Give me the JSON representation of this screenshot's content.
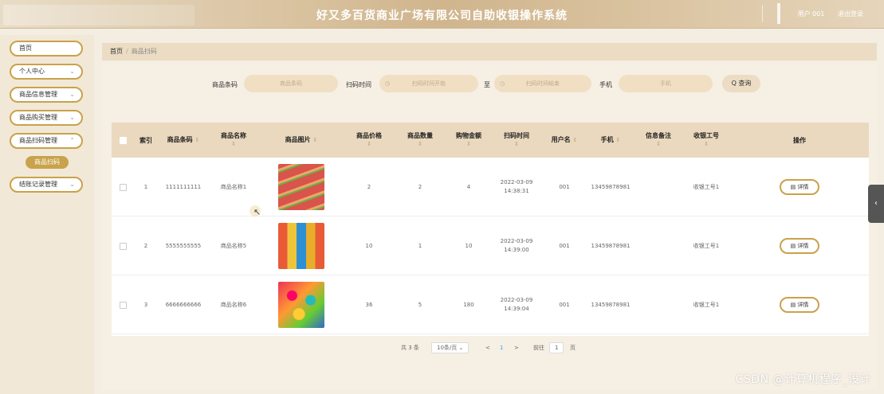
{
  "header": {
    "title": "好又多百货商业广场有限公司自助收银操作系统",
    "user": "用户 001",
    "logout": "退出登录"
  },
  "sidebar": {
    "items": [
      {
        "label": "首页",
        "chevron": ""
      },
      {
        "label": "个人中心",
        "chevron": "⌄"
      },
      {
        "label": "商品信息管理",
        "chevron": "⌄"
      },
      {
        "label": "商品购买管理",
        "chevron": "⌄"
      },
      {
        "label": "商品扫码管理",
        "chevron": "⌃"
      },
      {
        "label": "结账记录管理",
        "chevron": "⌄"
      }
    ],
    "active_sub": "商品扫码"
  },
  "breadcrumb": {
    "home": "首页",
    "sep": "/",
    "current": "商品扫码"
  },
  "search": {
    "barcode_label": "商品条码",
    "barcode_placeholder": "商品条码",
    "time_label": "扫码时间",
    "start_placeholder": "扫码时间开始",
    "to": "至",
    "end_placeholder": "扫码时间结束",
    "phone_label": "手机",
    "phone_placeholder": "手机",
    "query_button": "Q 查询"
  },
  "table": {
    "headers": {
      "index": "索引",
      "barcode": "商品条码",
      "name": "商品名称",
      "image": "商品图片",
      "price": "商品价格",
      "qty": "商品数量",
      "total": "购物金额",
      "time": "扫码时间",
      "user": "用户名",
      "phone": "手机",
      "note": "信息备注",
      "cashier": "收银工号",
      "action": "操作",
      "sort": "⇕"
    },
    "rows": [
      {
        "index": "1",
        "barcode": "1111111111",
        "name": "商品名称1",
        "price": "2",
        "qty": "2",
        "total": "4",
        "date": "2022-03-09",
        "time": "14:38:31",
        "user": "001",
        "phone": "13459878981",
        "note": "",
        "cashier": "收银工号1",
        "detail": "▤ 详情"
      },
      {
        "index": "2",
        "barcode": "5555555555",
        "name": "商品名称5",
        "price": "10",
        "qty": "1",
        "total": "10",
        "date": "2022-03-09",
        "time": "14:39:00",
        "user": "001",
        "phone": "13459878981",
        "note": "",
        "cashier": "收银工号1",
        "detail": "▤ 详情"
      },
      {
        "index": "3",
        "barcode": "6666666666",
        "name": "商品名称6",
        "price": "36",
        "qty": "5",
        "total": "180",
        "date": "2022-03-09",
        "time": "14:39:04",
        "user": "001",
        "phone": "13459878981",
        "note": "",
        "cashier": "收银工号1",
        "detail": "▤ 详情"
      }
    ]
  },
  "pager": {
    "total": "共 3 条",
    "page_size": "10条/页 ⌄",
    "prev": "<",
    "page": "1",
    "next": ">",
    "goto": "前往",
    "goto_value": "1",
    "page_unit": "页"
  },
  "side_tab": "‹",
  "watermark": "CSDN @计算机程序_设计"
}
